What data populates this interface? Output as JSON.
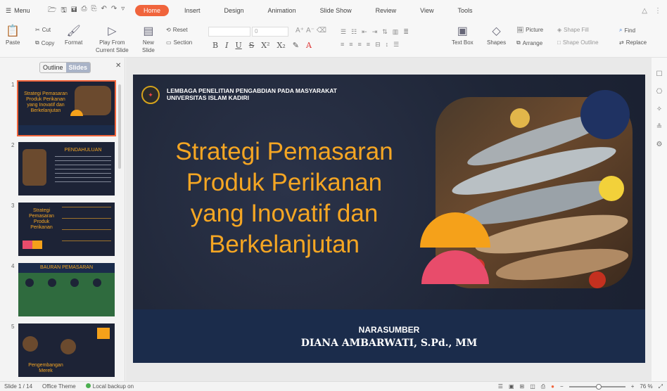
{
  "menubar": {
    "menu_label": "Menu",
    "tabs": [
      "Home",
      "Insert",
      "Design",
      "Animation",
      "Slide Show",
      "Review",
      "View",
      "Tools"
    ],
    "active_tab": "Home"
  },
  "ribbon": {
    "paste": "Paste",
    "cut": "Cut",
    "copy": "Copy",
    "format": "Format",
    "play_from": "Play From",
    "current_slide": "Current Slide",
    "new_slide_1": "New",
    "new_slide_2": "Slide",
    "reset": "Reset",
    "section": "Section",
    "font_size": "0",
    "text_box": "Text Box",
    "shapes": "Shapes",
    "picture": "Picture",
    "arrange": "Arrange",
    "shape_fill": "Shape Fill",
    "shape_outline": "Shape Outline",
    "find": "Find",
    "replace": "Replace"
  },
  "leftpane": {
    "outline": "Outline",
    "slides": "Slides",
    "thumbs": [
      {
        "num": "1",
        "title": "Strategi Pemasaran Produk Perikanan yang Inovatif dan Berkelanjutan"
      },
      {
        "num": "2",
        "title": "PENDAHULUAN"
      },
      {
        "num": "3",
        "title": "Strategi Pemasaran Produk Perikanan"
      },
      {
        "num": "4",
        "title": "BAURAN PEMASARAN"
      },
      {
        "num": "5",
        "title": "Pengembangan Merek"
      }
    ]
  },
  "slide": {
    "institution_line1": "LEMBAGA PENELITIAN PENGABDIAN PADA MASYARAKAT",
    "institution_line2": "UNIVERSITAS ISLAM KADIRI",
    "title_l1": "Strategi Pemasaran",
    "title_l2": "Produk Perikanan",
    "title_l3": "yang Inovatif dan",
    "title_l4": "Berkelanjutan",
    "narasumber": "NARASUMBER",
    "speaker": "DIANA AMBARWATI, S.Pd., MM"
  },
  "status": {
    "slide_counter": "Slide 1 / 14",
    "theme": "Office Theme",
    "backup": "Local backup on",
    "zoom": "76 %"
  },
  "colors": {
    "accent": "#f0643c",
    "title": "#f5a623",
    "slide_bg": "#222a3e",
    "footer": "#1b2c4b"
  }
}
